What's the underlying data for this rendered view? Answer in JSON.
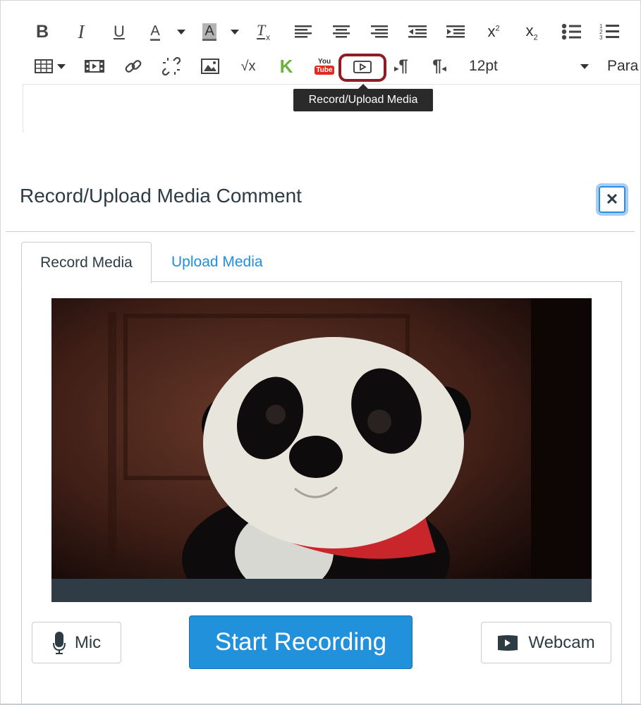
{
  "toolbar": {
    "row1": [
      {
        "name": "bold-button",
        "icon": "bold-icon"
      },
      {
        "name": "italic-button",
        "icon": "italic-icon"
      },
      {
        "name": "underline-button",
        "icon": "underline-icon"
      },
      {
        "name": "text-color-button",
        "icon": "text-color-icon"
      },
      {
        "name": "text-color-dropdown",
        "icon": "caret-down-icon"
      },
      {
        "name": "background-color-button",
        "icon": "background-color-icon"
      },
      {
        "name": "background-color-dropdown",
        "icon": "caret-down-icon"
      },
      {
        "name": "clear-formatting-button",
        "icon": "clear-formatting-icon"
      },
      {
        "name": "align-left-button",
        "icon": "align-left-icon"
      },
      {
        "name": "align-center-button",
        "icon": "align-center-icon"
      },
      {
        "name": "align-right-button",
        "icon": "align-right-icon"
      },
      {
        "name": "outdent-button",
        "icon": "outdent-icon"
      },
      {
        "name": "indent-button",
        "icon": "indent-icon"
      },
      {
        "name": "superscript-button",
        "icon": "superscript-icon"
      },
      {
        "name": "subscript-button",
        "icon": "subscript-icon"
      },
      {
        "name": "bullet-list-button",
        "icon": "bullet-list-icon"
      },
      {
        "name": "numbered-list-button",
        "icon": "numbered-list-icon"
      }
    ],
    "row2": [
      {
        "name": "table-button",
        "icon": "table-icon"
      },
      {
        "name": "embed-media-button",
        "icon": "film-icon"
      },
      {
        "name": "link-button",
        "icon": "link-icon"
      },
      {
        "name": "unlink-button",
        "icon": "unlink-icon"
      },
      {
        "name": "image-button",
        "icon": "image-icon"
      },
      {
        "name": "equation-button",
        "icon": "square-root-icon"
      },
      {
        "name": "kaltura-button",
        "icon": "k-logo-icon"
      },
      {
        "name": "youtube-button",
        "icon": "youtube-icon"
      },
      {
        "name": "record-upload-media-button",
        "icon": "play-media-icon"
      },
      {
        "name": "ltr-button",
        "icon": "ltr-paragraph-icon"
      },
      {
        "name": "rtl-button",
        "icon": "rtl-paragraph-icon"
      }
    ],
    "font_size": "12pt",
    "paragraph_label": "Para",
    "youtube_top": "You",
    "youtube_bottom": "Tube",
    "superscript_glyph": "x",
    "superscript_digit": "2",
    "subscript_digit": "2",
    "equation_glyph": "√x",
    "kaltura_glyph": "K"
  },
  "tooltip": "Record/Upload Media",
  "dialog": {
    "title": "Record/Upload Media Comment",
    "close_label": "✕",
    "tabs": [
      {
        "label": "Record Media",
        "active": true
      },
      {
        "label": "Upload Media",
        "active": false
      }
    ],
    "buttons": {
      "mic": "Mic",
      "start": "Start Recording",
      "webcam": "Webcam"
    }
  },
  "colors": {
    "accent": "#2191dc",
    "link": "#1f8ee0",
    "highlight": "#8f1c22",
    "video_bar": "#2f3b45"
  }
}
